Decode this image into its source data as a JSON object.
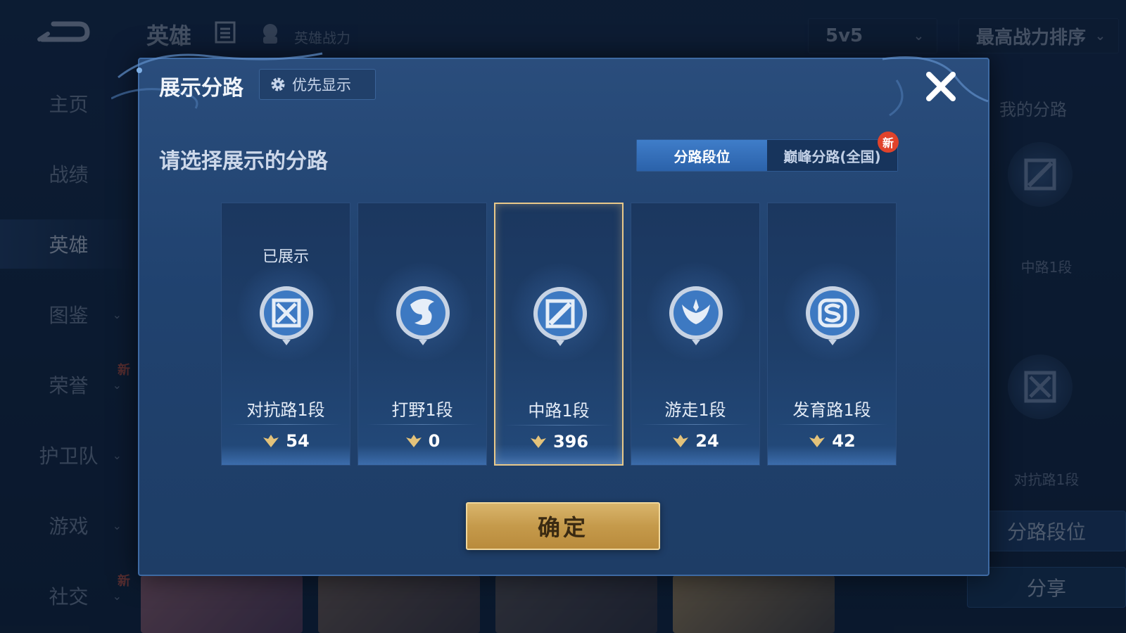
{
  "background": {
    "top_title": "英雄",
    "power_label": "英雄战力",
    "mode_select": "5v5",
    "sort_select": "最高战力排序",
    "nav": [
      {
        "label": "主页",
        "chevron": false,
        "new": ""
      },
      {
        "label": "战绩",
        "chevron": false,
        "new": ""
      },
      {
        "label": "英雄",
        "chevron": false,
        "new": "",
        "active": true
      },
      {
        "label": "图鉴",
        "chevron": true,
        "new": ""
      },
      {
        "label": "荣誉",
        "chevron": true,
        "new": "新"
      },
      {
        "label": "护卫队",
        "chevron": true,
        "new": ""
      },
      {
        "label": "游戏",
        "chevron": true,
        "new": ""
      },
      {
        "label": "社交",
        "chevron": true,
        "new": "新"
      }
    ],
    "right_panel": {
      "title": "我的分路",
      "lane1_label": "中路1段",
      "lane2_label": "对抗路1段",
      "lane_rank_button": "分路段位",
      "share_button": "分享"
    }
  },
  "modal": {
    "title": "展示分路",
    "priority_button": "优先显示",
    "subtitle": "请选择展示的分路",
    "tabs": [
      {
        "label": "分路段位",
        "active": true,
        "badge": ""
      },
      {
        "label": "巅峰分路(全国)",
        "active": false,
        "badge": "新"
      }
    ],
    "cards": [
      {
        "shown_label": "已展示",
        "name": "对抗路1段",
        "score": "54",
        "icon": "clash-lane-icon",
        "selected": false
      },
      {
        "shown_label": "",
        "name": "打野1段",
        "score": "0",
        "icon": "jungle-dragon-icon",
        "selected": false
      },
      {
        "shown_label": "",
        "name": "中路1段",
        "score": "396",
        "icon": "mid-lane-icon",
        "selected": true
      },
      {
        "shown_label": "",
        "name": "游走1段",
        "score": "24",
        "icon": "roam-wings-icon",
        "selected": false
      },
      {
        "shown_label": "",
        "name": "发育路1段",
        "score": "42",
        "icon": "farm-lane-icon",
        "selected": false
      }
    ],
    "confirm_button": "确定"
  },
  "colors": {
    "accent_gold": "#e9c98a",
    "tab_active": "#3f7dc9",
    "badge_red": "#e0432b"
  }
}
